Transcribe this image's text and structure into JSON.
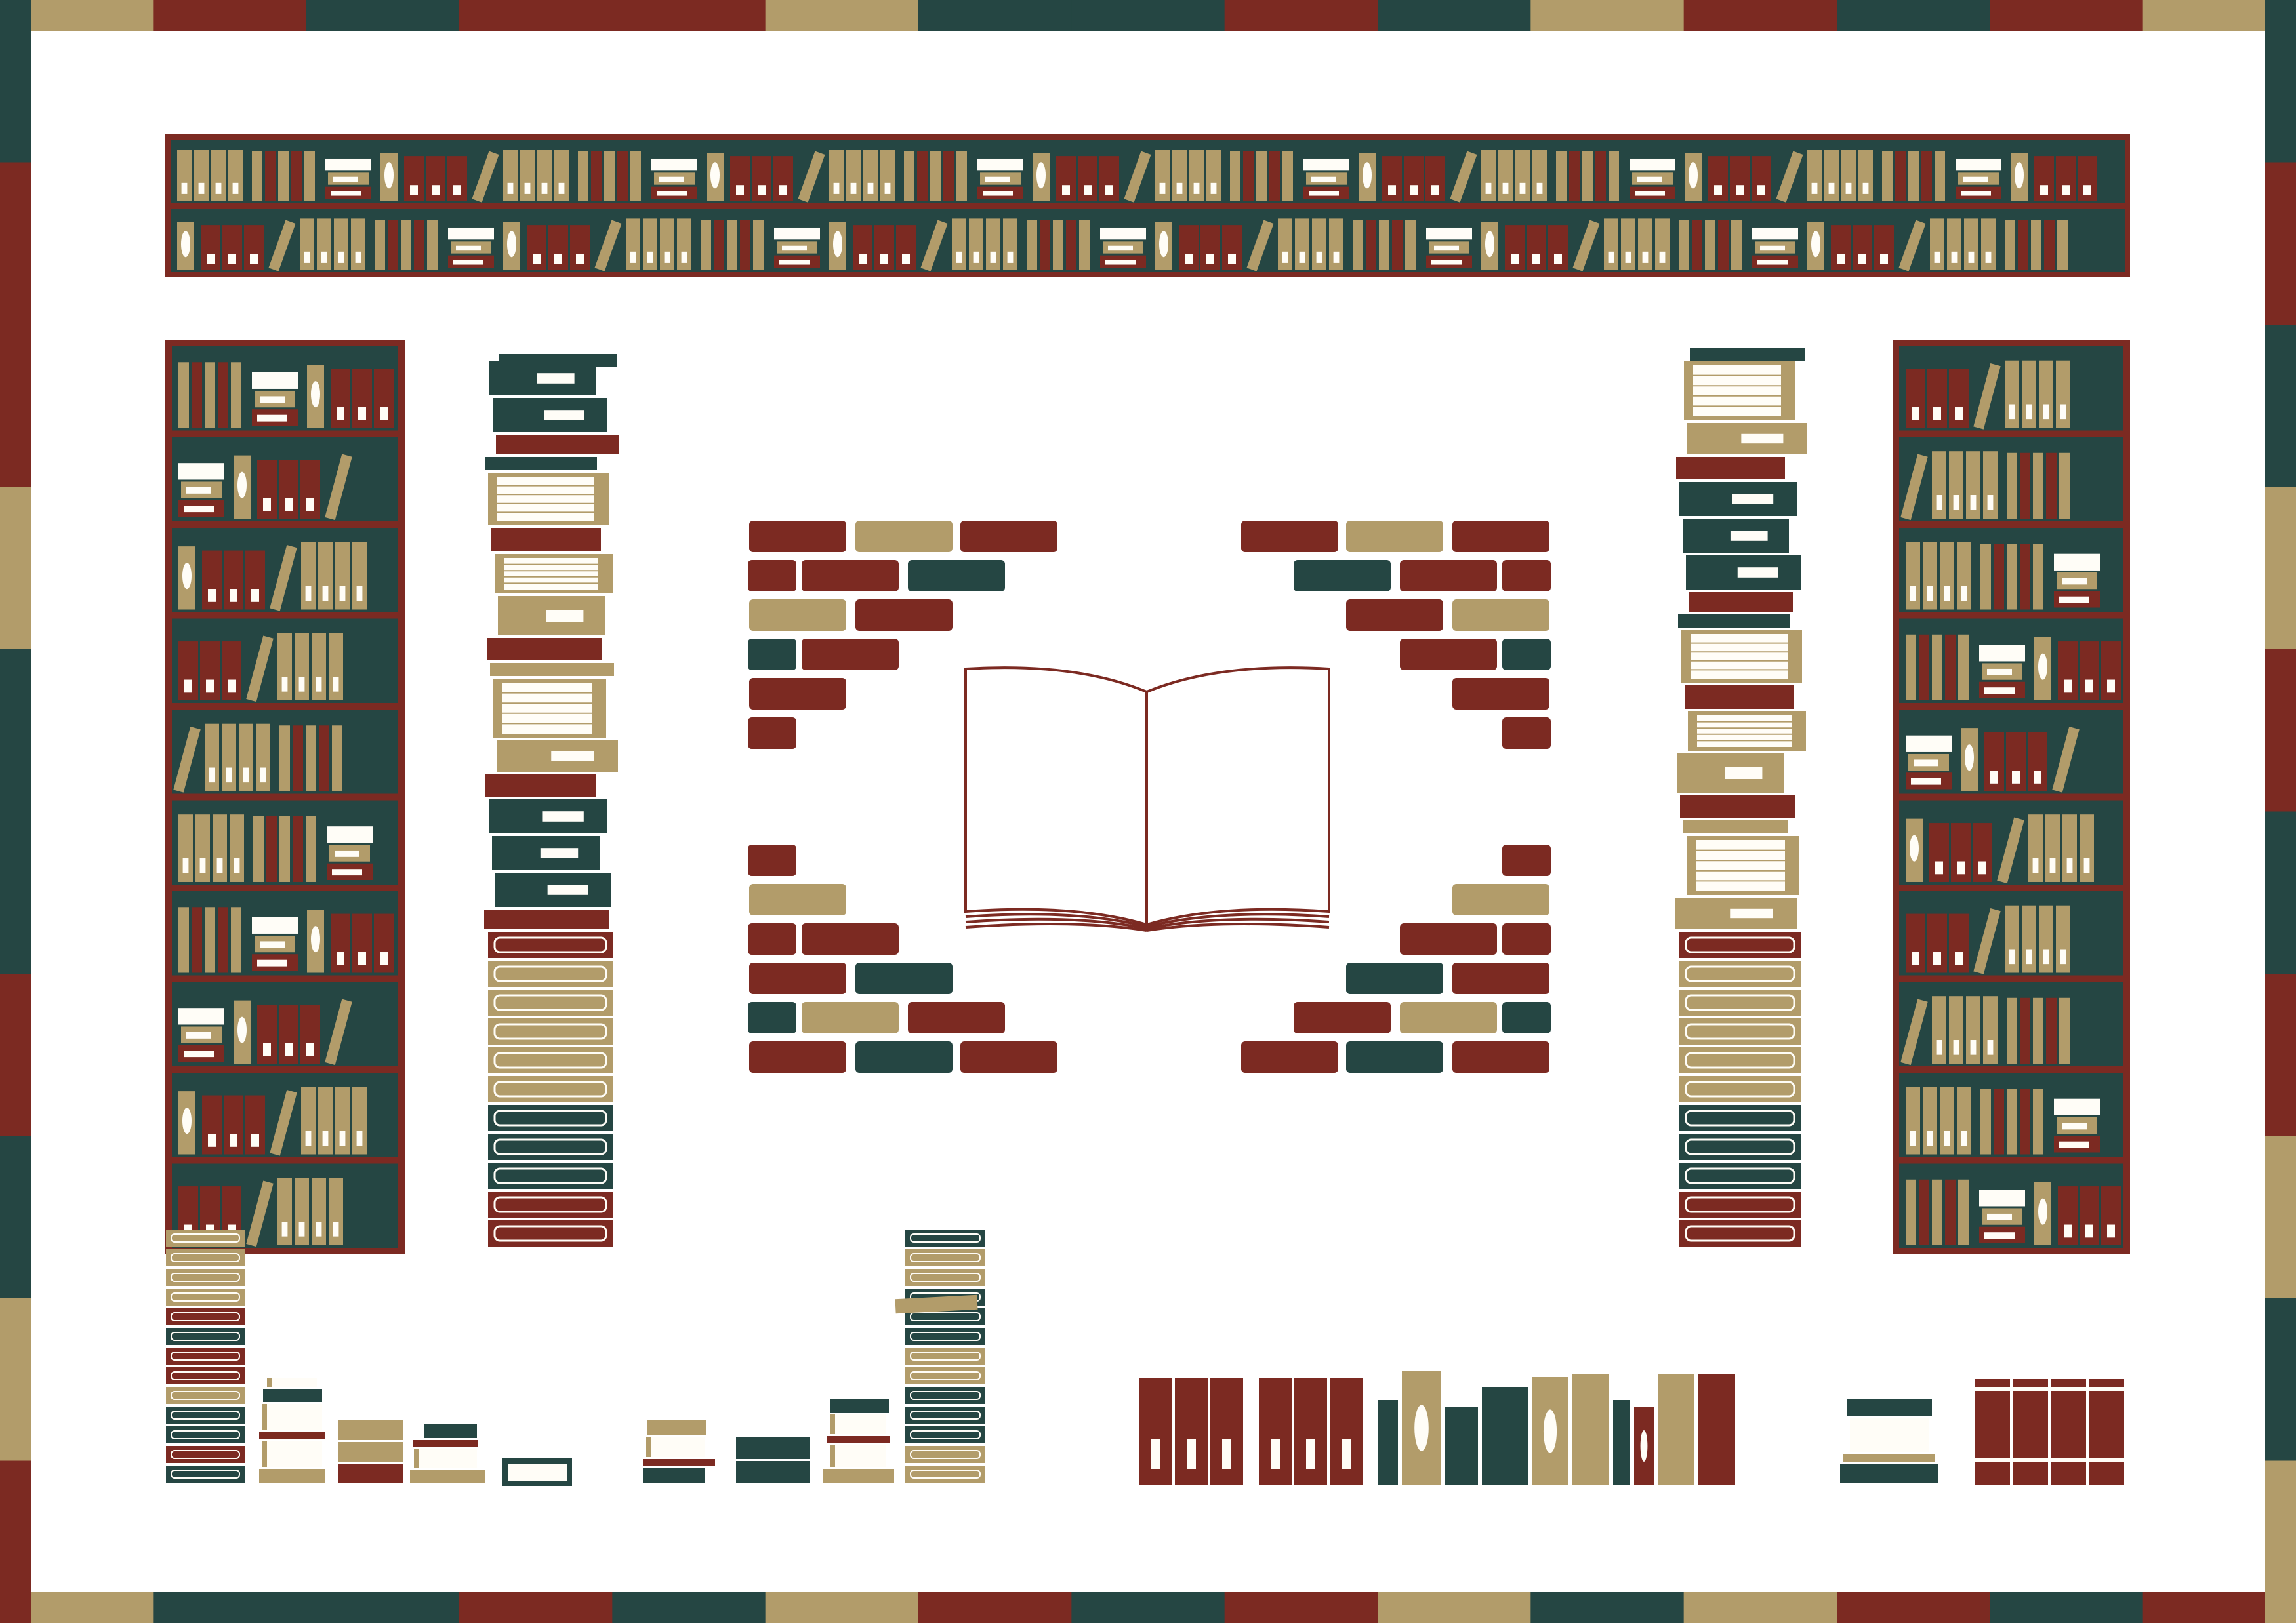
{
  "palette": {
    "red": "#7c2a22",
    "tan": "#b29c6a",
    "green": "#254643",
    "cream": "#fffdf7",
    "page_line": "#ffffff",
    "background": "#ffffff"
  },
  "icons": [
    "decorative-frame",
    "top-bookshelf",
    "left-bookcase",
    "right-bookcase",
    "left-book-stack",
    "right-book-stack",
    "brick-border",
    "open-book-icon",
    "small-book-stacks",
    "bookend-row"
  ],
  "scene": {
    "description_visible_text": ""
  }
}
